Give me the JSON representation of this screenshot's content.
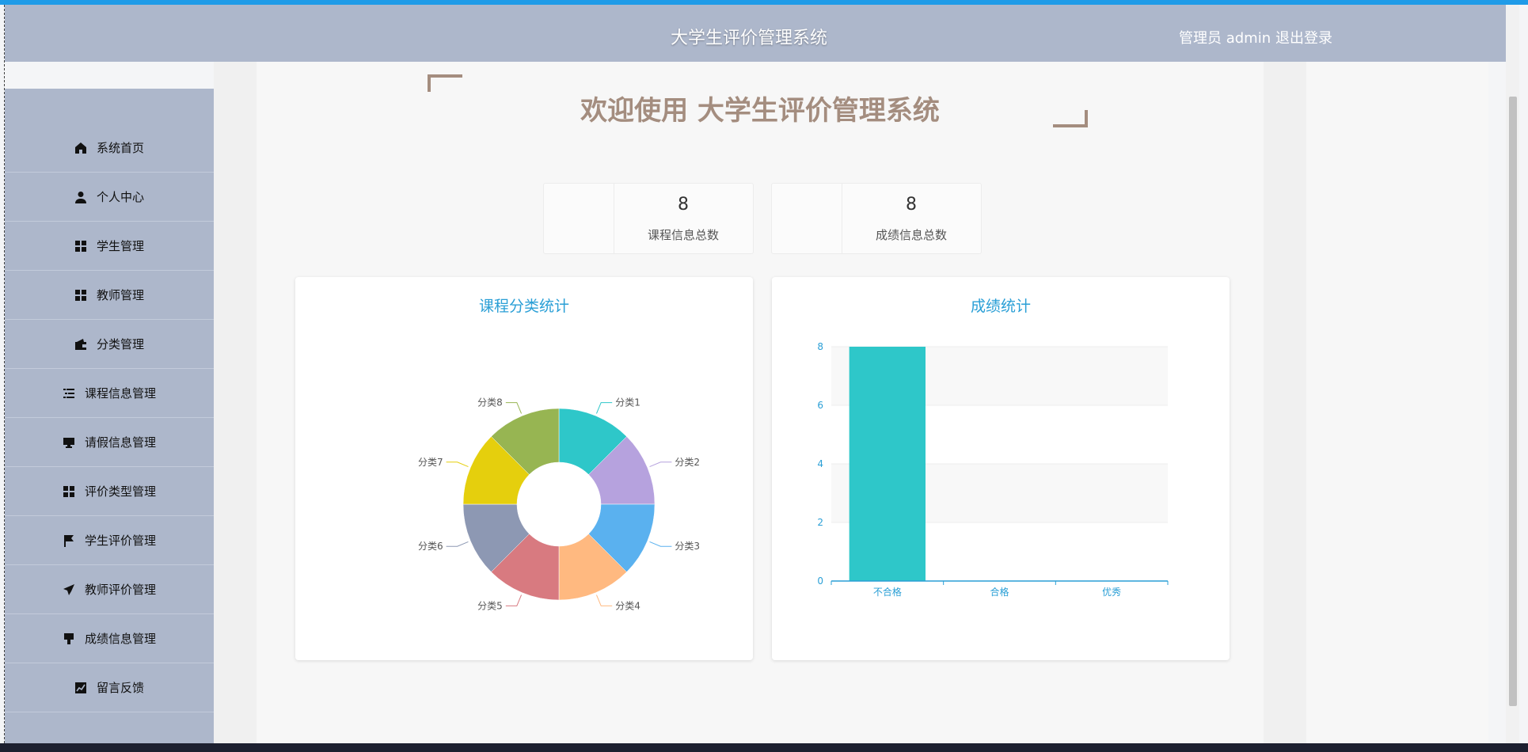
{
  "header": {
    "title": "大学生评价管理系统",
    "user": "管理员 admin",
    "logout": "退出登录"
  },
  "sidebar": {
    "items": [
      {
        "label": "系统首页",
        "icon": "home-icon"
      },
      {
        "label": "个人中心",
        "icon": "user-icon"
      },
      {
        "label": "学生管理",
        "icon": "grid-icon"
      },
      {
        "label": "教师管理",
        "icon": "grid-icon"
      },
      {
        "label": "分类管理",
        "icon": "wallet-icon"
      },
      {
        "label": "课程信息管理",
        "icon": "list-icon"
      },
      {
        "label": "请假信息管理",
        "icon": "monitor-icon"
      },
      {
        "label": "评价类型管理",
        "icon": "grid-icon"
      },
      {
        "label": "学生评价管理",
        "icon": "flag-icon"
      },
      {
        "label": "教师评价管理",
        "icon": "send-icon"
      },
      {
        "label": "成绩信息管理",
        "icon": "brush-icon"
      },
      {
        "label": "留言反馈",
        "icon": "chart-line-icon"
      }
    ]
  },
  "main": {
    "welcome": "欢迎使用 大学生评价管理系统",
    "stats": [
      {
        "value": "8",
        "label": "课程信息总数"
      },
      {
        "value": "8",
        "label": "成绩信息总数"
      }
    ]
  },
  "colors": {
    "header_bg": "#adb7cb",
    "accent_title": "#2a9fd6",
    "welcome_text": "#a48d7f",
    "bar_color": "#2ec7c9"
  },
  "chart_data": [
    {
      "type": "pie",
      "title": "课程分类统计",
      "donut": true,
      "labels": [
        "分类1",
        "分类2",
        "分类3",
        "分类4",
        "分类5",
        "分类6",
        "分类7",
        "分类8"
      ],
      "values": [
        1,
        1,
        1,
        1,
        1,
        1,
        1,
        1
      ],
      "colors": [
        "#2ec7c9",
        "#b6a2de",
        "#5ab1ef",
        "#ffb980",
        "#d87a80",
        "#8d98b3",
        "#e5cf0d",
        "#97b552"
      ]
    },
    {
      "type": "bar",
      "title": "成绩统计",
      "categories": [
        "不合格",
        "合格",
        "优秀"
      ],
      "values": [
        8,
        0,
        0
      ],
      "ylim": [
        0,
        8
      ],
      "yticks": [
        "0",
        "2",
        "4",
        "6",
        "8"
      ],
      "grid": true,
      "bar_color": "#2ec7c9"
    }
  ]
}
